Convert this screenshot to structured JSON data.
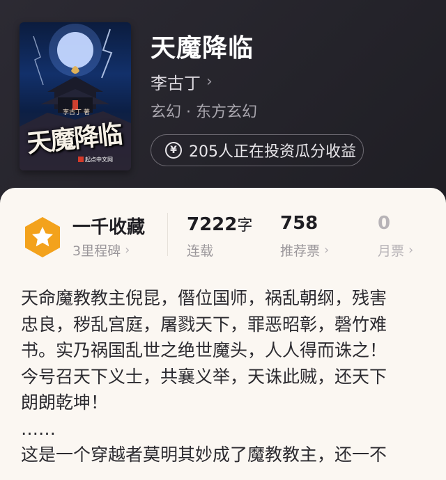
{
  "book": {
    "title": "天魔降临",
    "author": "李古丁",
    "genre": "玄幻 · 东方玄幻",
    "invest_text": "205人正在投资瓜分收益",
    "cover": {
      "title": "天魔降临",
      "author_mark": "李古丁 著",
      "publisher": "起点中文网"
    }
  },
  "stats": {
    "collect": {
      "title": "一千收藏",
      "sub": "3里程碑"
    },
    "words": {
      "value": "7222",
      "unit": "字",
      "sub": "连载"
    },
    "recommend": {
      "value": "758",
      "sub": "推荐票"
    },
    "monthly": {
      "value": "0",
      "sub": "月票"
    }
  },
  "description": [
    "天命魔教教主倪昆，僭位国师，祸乱朝纲，残害",
    "忠良，秽乱宫庭，屠戮天下，罪恶昭彰，磬竹难",
    "书。实乃祸国乱世之绝世魔头，人人得而诛之！",
    "今号召天下义士，共襄义举，天诛此贼，还天下",
    "朗朗乾坤！",
    "……",
    "这是一个穿越者莫明其妙成了魔教教主，还一不"
  ],
  "colors": {
    "badge": "#f3a21c",
    "panel": "#fbf7f2",
    "header": "#2a2830"
  }
}
